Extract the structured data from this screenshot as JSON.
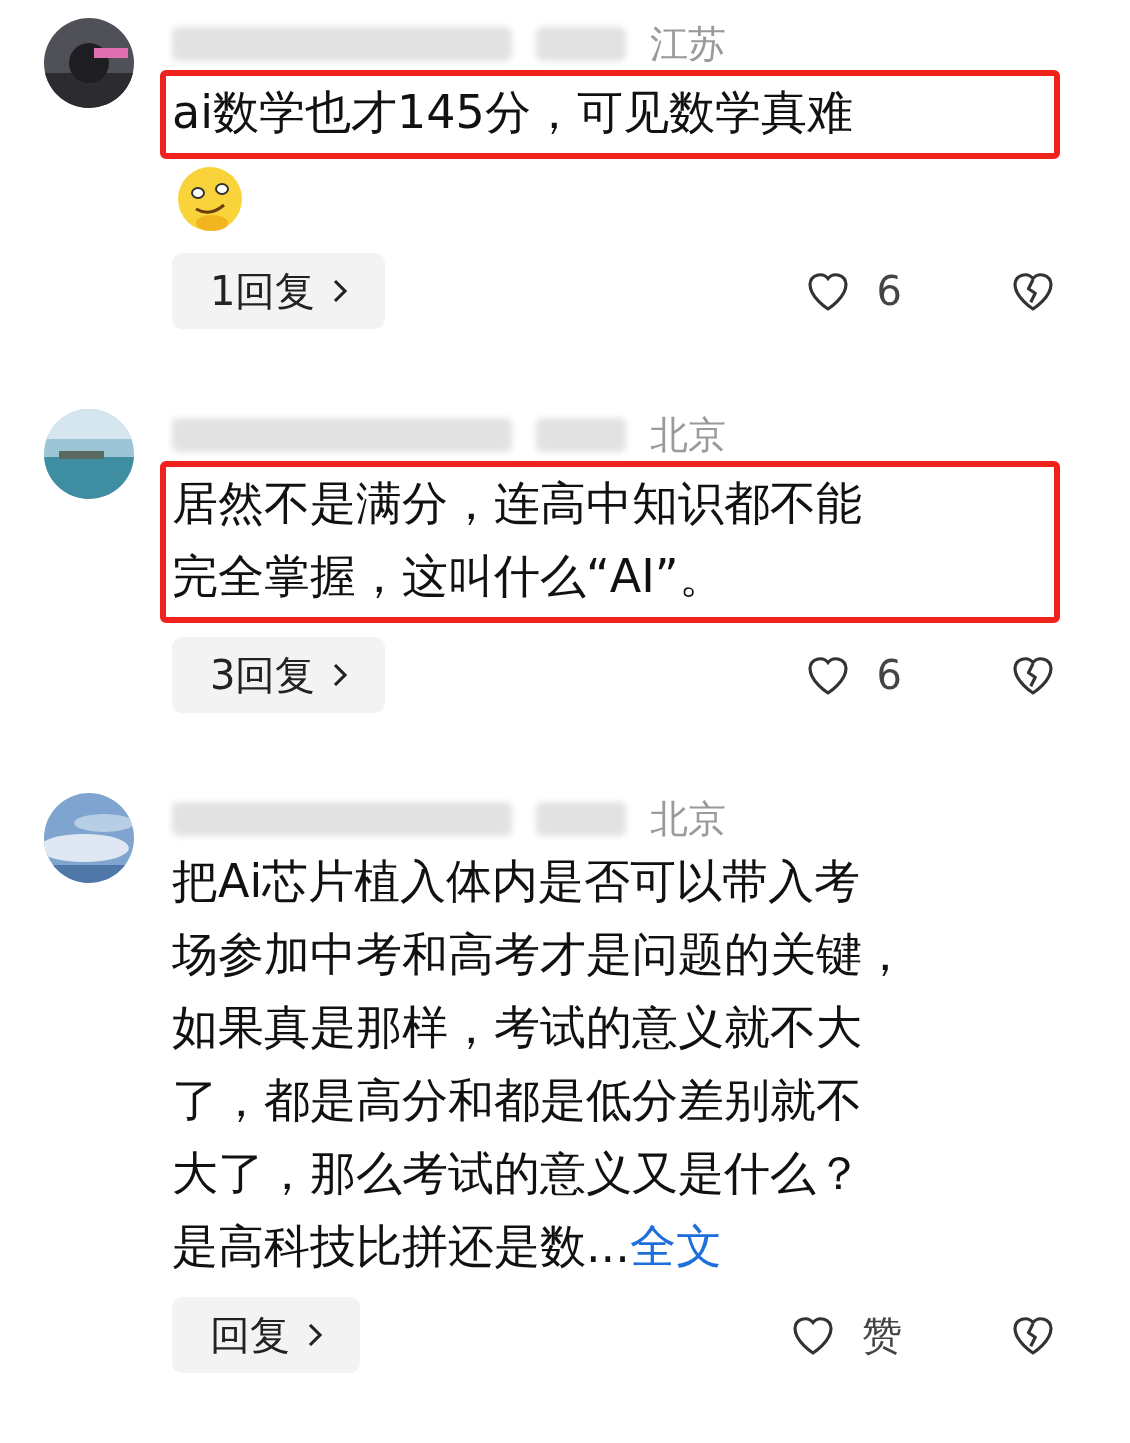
{
  "comments": [
    {
      "location": "江苏",
      "lines": [
        "ai数学也才145分，可见数学真难"
      ],
      "highlighted": true,
      "sticker": true,
      "replies": "1回复",
      "likes": "6"
    },
    {
      "location": "北京",
      "lines": [
        "居然不是满分，连高中知识都不能",
        "完全掌握，这叫什么“AI”。"
      ],
      "highlighted": true,
      "sticker": false,
      "replies": "3回复",
      "likes": "6"
    },
    {
      "location": "北京",
      "lines": [
        "把Ai芯片植入体内是否可以带入考",
        "场参加中考和高考才是问题的关键，",
        "如果真是那样，考试的意义就不大",
        "了，都是高分和都是低分差别就不",
        "大了，那么考试的意义又是什么？",
        "是高科技比拼还是数..."
      ],
      "more": "全文",
      "highlighted": false,
      "sticker": false,
      "replies": "回复",
      "likes": "赞"
    }
  ]
}
